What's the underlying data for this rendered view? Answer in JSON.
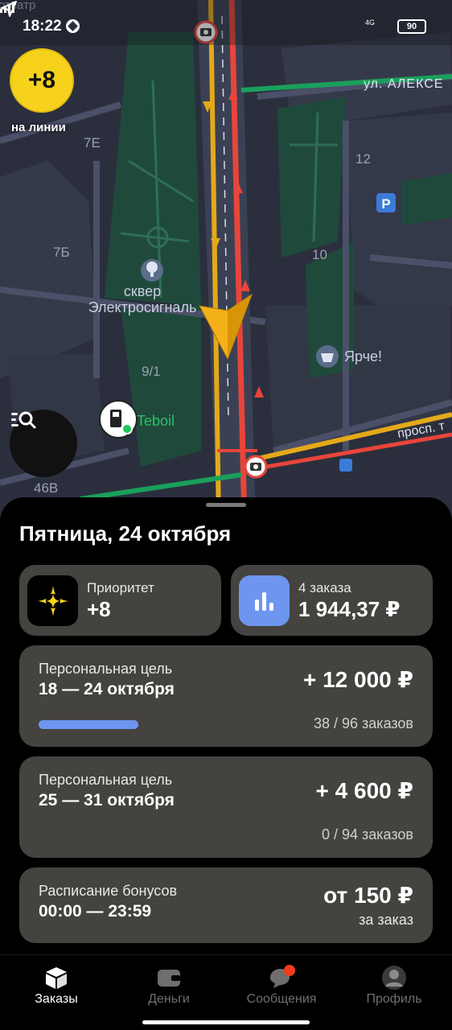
{
  "status_bar": {
    "time": "18:22",
    "network": "4G",
    "battery": "90"
  },
  "map": {
    "top_left_label": "отеатр",
    "street_top": "ул. АЛЕКСЕ",
    "street_right": "просп. т",
    "building_labels": [
      "7Е",
      "12",
      "7Б",
      "10",
      "9/1",
      "46В"
    ],
    "park_label_line1": "сквер",
    "park_label_line2": "Электросигналь",
    "shop_label": "Ярче!",
    "fuel_label": "Teboil",
    "parking_icon": "P",
    "colors": {
      "road_red": "#e8453a",
      "road_yellow": "#e4a91a",
      "road_green": "#1aa05b",
      "park": "#1f4a3b",
      "navigator_arrow": "#f5b11a"
    }
  },
  "priority_badge": {
    "value": "+8",
    "caption": "на линии"
  },
  "sheet": {
    "title": "Пятница, 24 октября",
    "priority_card": {
      "label": "Приоритет",
      "value": "+8",
      "icon": "priority-star-icon"
    },
    "orders_card": {
      "label": "4 заказа",
      "value": "1 944,37 ₽",
      "icon": "bar-chart-icon"
    },
    "goals": [
      {
        "label": "Персональная цель",
        "dates": "18 — 24 октября",
        "amount": "+ 12 000 ₽",
        "count": "38 / 96 заказов",
        "progress": 0.4
      },
      {
        "label": "Персональная цель",
        "dates": "25 — 31 октября",
        "amount": "+ 4 600 ₽",
        "count": "0 / 94 заказов"
      }
    ],
    "schedule": {
      "label": "Расписание бонусов",
      "time": "00:00 — 23:59",
      "amount": "от 150 ₽",
      "sub": "за заказ"
    }
  },
  "bottom_nav": {
    "orders": "Заказы",
    "money": "Деньги",
    "messages": "Сообщения",
    "profile": "Профиль"
  }
}
